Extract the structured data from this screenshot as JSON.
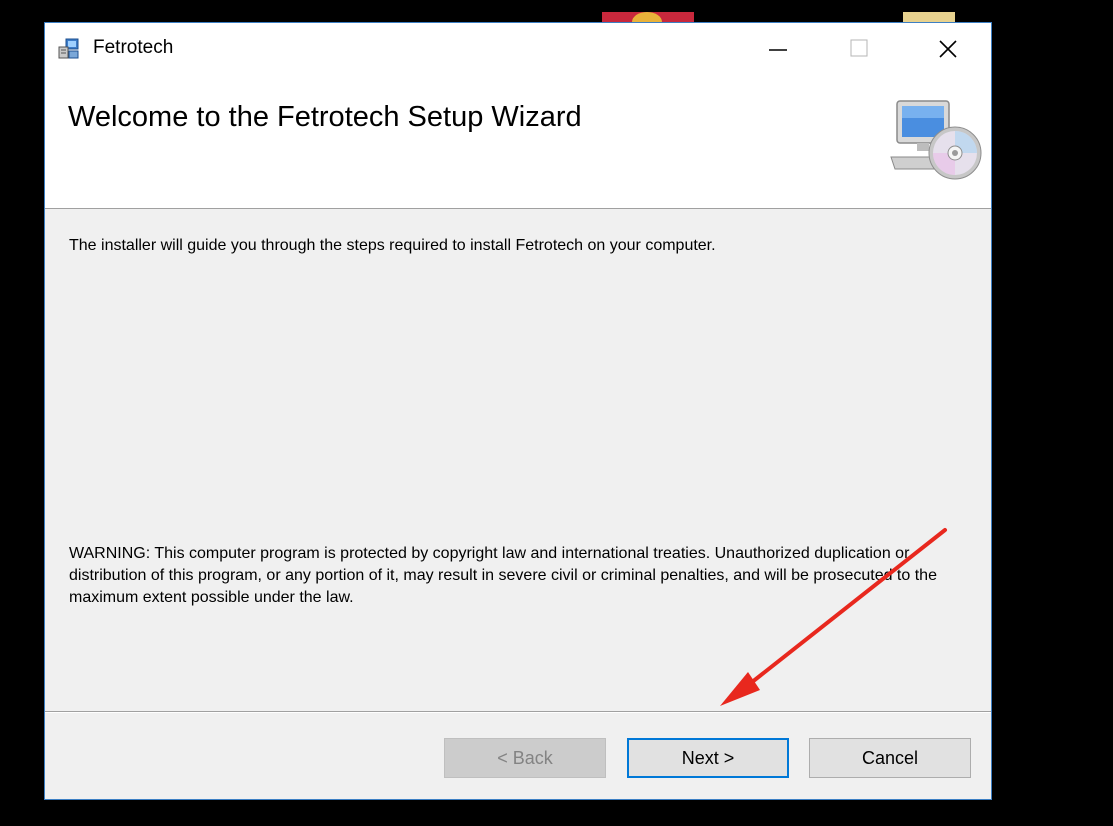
{
  "window": {
    "title": "Fetrotech",
    "controls": {
      "minimize": "minimize-icon",
      "maximize": "maximize-icon",
      "close": "close-icon"
    }
  },
  "header": {
    "title": "Welcome to the Fetrotech Setup Wizard",
    "graphic": "computer-cd-icon"
  },
  "body": {
    "intro": "The installer will guide you through the steps required to install Fetrotech on your computer.",
    "warning": "WARNING: This computer program is protected by copyright law and international treaties. Unauthorized duplication or distribution of this program, or any portion of it, may result in severe civil or criminal penalties, and will be prosecuted to the maximum extent possible under the law."
  },
  "buttons": {
    "back": "< Back",
    "next": "Next >",
    "cancel": "Cancel"
  },
  "colors": {
    "accent": "#0078d7",
    "annotation_arrow": "#e8281e",
    "disabled_text": "#838383"
  }
}
